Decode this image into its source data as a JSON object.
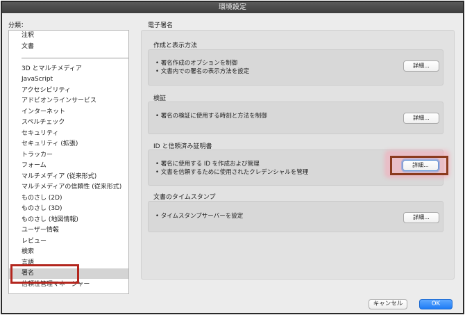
{
  "window": {
    "title": "環境設定"
  },
  "categories": {
    "label": "分類：",
    "top_items": [
      "注釈",
      "文書"
    ],
    "items": [
      "3D とマルチメディア",
      "JavaScript",
      "アクセシビリティ",
      "アドビオンラインサービス",
      "インターネット",
      "スペルチェック",
      "セキュリティ",
      "セキュリティ (拡張)",
      "トラッカー",
      "フォーム",
      "マルチメディア (従来形式)",
      "マルチメディアの信頼性 (従来形式)",
      "ものさし (2D)",
      "ものさし (3D)",
      "ものさし (地図情報)",
      "ユーザー情報",
      "レビュー",
      "検索",
      "言語",
      "署名",
      "信頼性管理マネージャー"
    ],
    "selected": "署名"
  },
  "main": {
    "title": "電子署名",
    "sections": [
      {
        "title": "作成と表示方法",
        "bullets": [
          "署名作成のオプションを制御",
          "文書内での署名の表示方法を設定"
        ],
        "button": "詳細..."
      },
      {
        "title": "検証",
        "bullets": [
          "署名の検証に使用する時刻と方法を制御"
        ],
        "button": "詳細..."
      },
      {
        "title": "ID と信頼済み証明書",
        "bullets": [
          "署名に使用する ID を作成および管理",
          "文書を信頼するために使用されたクレデンシャルを管理"
        ],
        "button": "詳細..."
      },
      {
        "title": "文書のタイムスタンプ",
        "bullets": [
          "タイムスタンプサーバーを設定"
        ],
        "button": "詳細..."
      }
    ]
  },
  "footer": {
    "cancel": "キャンセル",
    "ok": "OK"
  }
}
